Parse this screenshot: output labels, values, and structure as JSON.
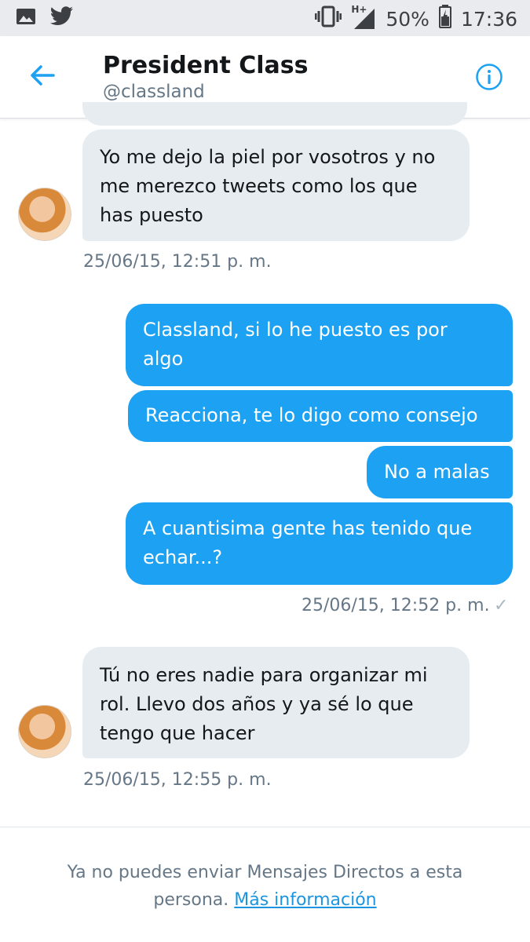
{
  "status_bar": {
    "signal_label": "H+",
    "battery": "50%",
    "time": "17:36"
  },
  "header": {
    "title": "President Class",
    "handle": "@classland"
  },
  "messages": [
    {
      "direction": "in",
      "lines": [
        "Yo me dejo la piel por vosotros y no",
        "me merezco tweets como los que",
        "has puesto"
      ]
    },
    {
      "direction": "out",
      "lines": [
        "Classland, si lo he puesto es por",
        "algo"
      ]
    },
    {
      "direction": "out",
      "lines": [
        "Reacciona, te lo digo como consejo"
      ]
    },
    {
      "direction": "out",
      "lines": [
        "No a malas"
      ]
    },
    {
      "direction": "out",
      "lines": [
        "A cuantisima gente has tenido que",
        "echar...?"
      ]
    },
    {
      "direction": "in",
      "lines": [
        "Tú no eres nadie para organizar mi",
        "rol. Llevo dos años y ya sé lo que",
        "tengo que hacer"
      ]
    }
  ],
  "timestamps": {
    "first": "25/06/15, 12:51 p. m.",
    "second": "25/06/15, 12:52 p. m.",
    "third": "25/06/15, 12:55 p. m.",
    "read_mark": "✓"
  },
  "footer": {
    "notice_text": "Ya no puedes enviar Mensajes Directos a esta persona.",
    "link_text": "Más información"
  },
  "colors": {
    "accent": "#1da1f2",
    "incoming_bubble": "#e6ecf0",
    "status_bar": "#e9ebee"
  }
}
